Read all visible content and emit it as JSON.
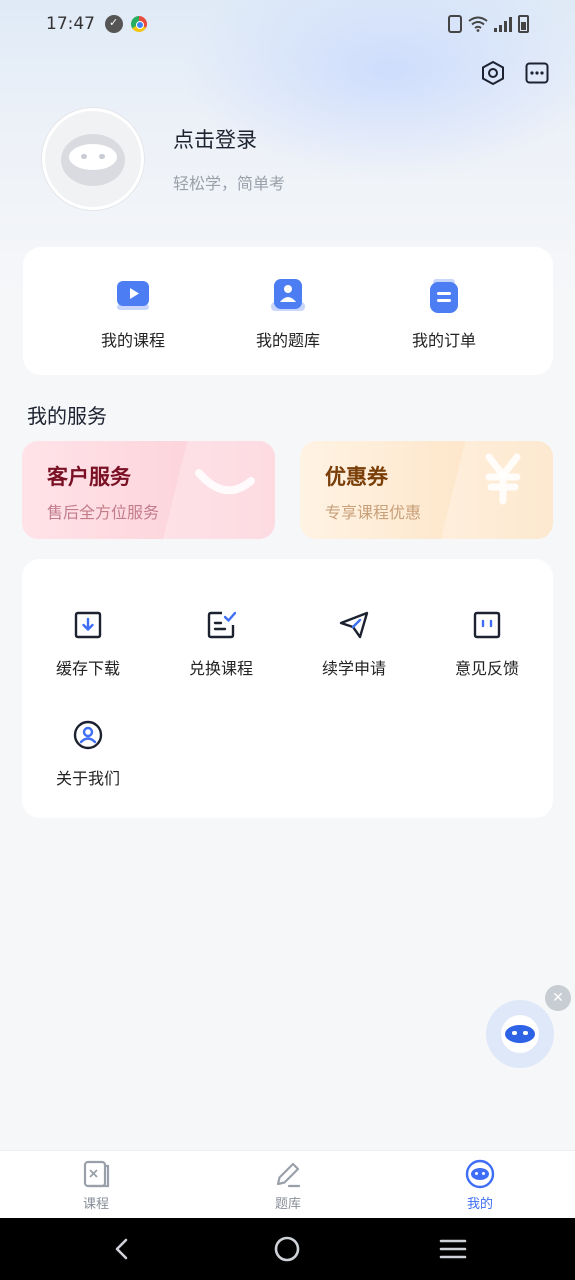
{
  "status_bar": {
    "time": "17:47"
  },
  "header": {
    "settings_icon": "hexagon-settings-icon",
    "more_icon": "message-more-icon"
  },
  "profile": {
    "login_label": "点击登录",
    "tagline": "轻松学，简单考"
  },
  "quick_links": [
    {
      "label": "我的课程",
      "icon": "video-course-icon"
    },
    {
      "label": "我的题库",
      "icon": "question-bank-icon"
    },
    {
      "label": "我的订单",
      "icon": "order-icon"
    }
  ],
  "services": {
    "title": "我的服务",
    "customer_service": {
      "title": "客户服务",
      "subtitle": "售后全方位服务"
    },
    "coupon": {
      "title": "优惠券",
      "subtitle": "专享课程优惠"
    }
  },
  "tools": [
    {
      "label": "缓存下载",
      "icon": "download-icon"
    },
    {
      "label": "兑换课程",
      "icon": "redeem-icon"
    },
    {
      "label": "续学申请",
      "icon": "send-icon"
    },
    {
      "label": "意见反馈",
      "icon": "feedback-icon"
    },
    {
      "label": "关于我们",
      "icon": "about-icon"
    }
  ],
  "tabbar": [
    {
      "label": "课程",
      "active": false
    },
    {
      "label": "题库",
      "active": false
    },
    {
      "label": "我的",
      "active": true
    }
  ],
  "colors": {
    "accent": "#3d6ef5",
    "background": "#f6f7f9"
  }
}
